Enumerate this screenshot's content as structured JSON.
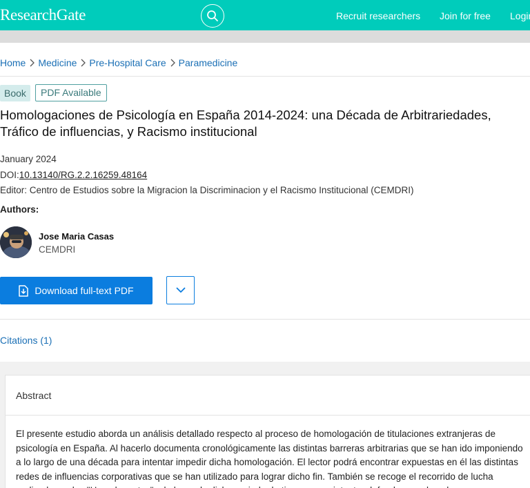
{
  "header": {
    "brand": "ResearchGate",
    "recruit": "Recruit researchers",
    "join": "Join for free",
    "login": "Login"
  },
  "breadcrumb": [
    "Home",
    "Medicine",
    "Pre-Hospital Care",
    "Paramedicine"
  ],
  "badges": {
    "type": "Book",
    "pdf": "PDF Available"
  },
  "publication": {
    "title": "Homologaciones de Psicología en España 2014-2024: una Década de Arbitrariedades, Tráfico de influencias, y Racismo institucional",
    "date": "January 2024",
    "doi_label": "DOI:",
    "doi": "10.13140/RG.2.2.16259.48164",
    "editor": "Editor: Centro de Estudios sobre la Migracion la Discriminacion y el Racismo Institucional (CEMDRI)"
  },
  "authors": {
    "label": "Authors:",
    "items": [
      {
        "name": "Jose Maria Casas",
        "affiliation": "CEMDRI"
      }
    ]
  },
  "actions": {
    "download": "Download full-text PDF"
  },
  "tabs": {
    "citations": "Citations (1)"
  },
  "abstract": {
    "heading": "Abstract",
    "text": "El presente estudio aborda un análisis detallado respecto al proceso de homologación de titulaciones extranjeras de psicología en España. Al hacerlo documenta cronológicamente las distintas barreras arbitrarias que se han ido imponiendo a lo largo de una década para intentar impedir dicha homologación. El lector podrá encontrar expuestas en él las distintas redes de influencias corporativas que se han utilizado para lograr dicho fin. También se recoge el recorrido de lucha realizado por los \"Homologantes\" a lo largo de dicho periodo de tiempo para intentar defender sus derechos y"
  },
  "colors": {
    "brand": "#00ccbb",
    "primary": "#0b7ddf",
    "link": "#1a6fb5"
  }
}
